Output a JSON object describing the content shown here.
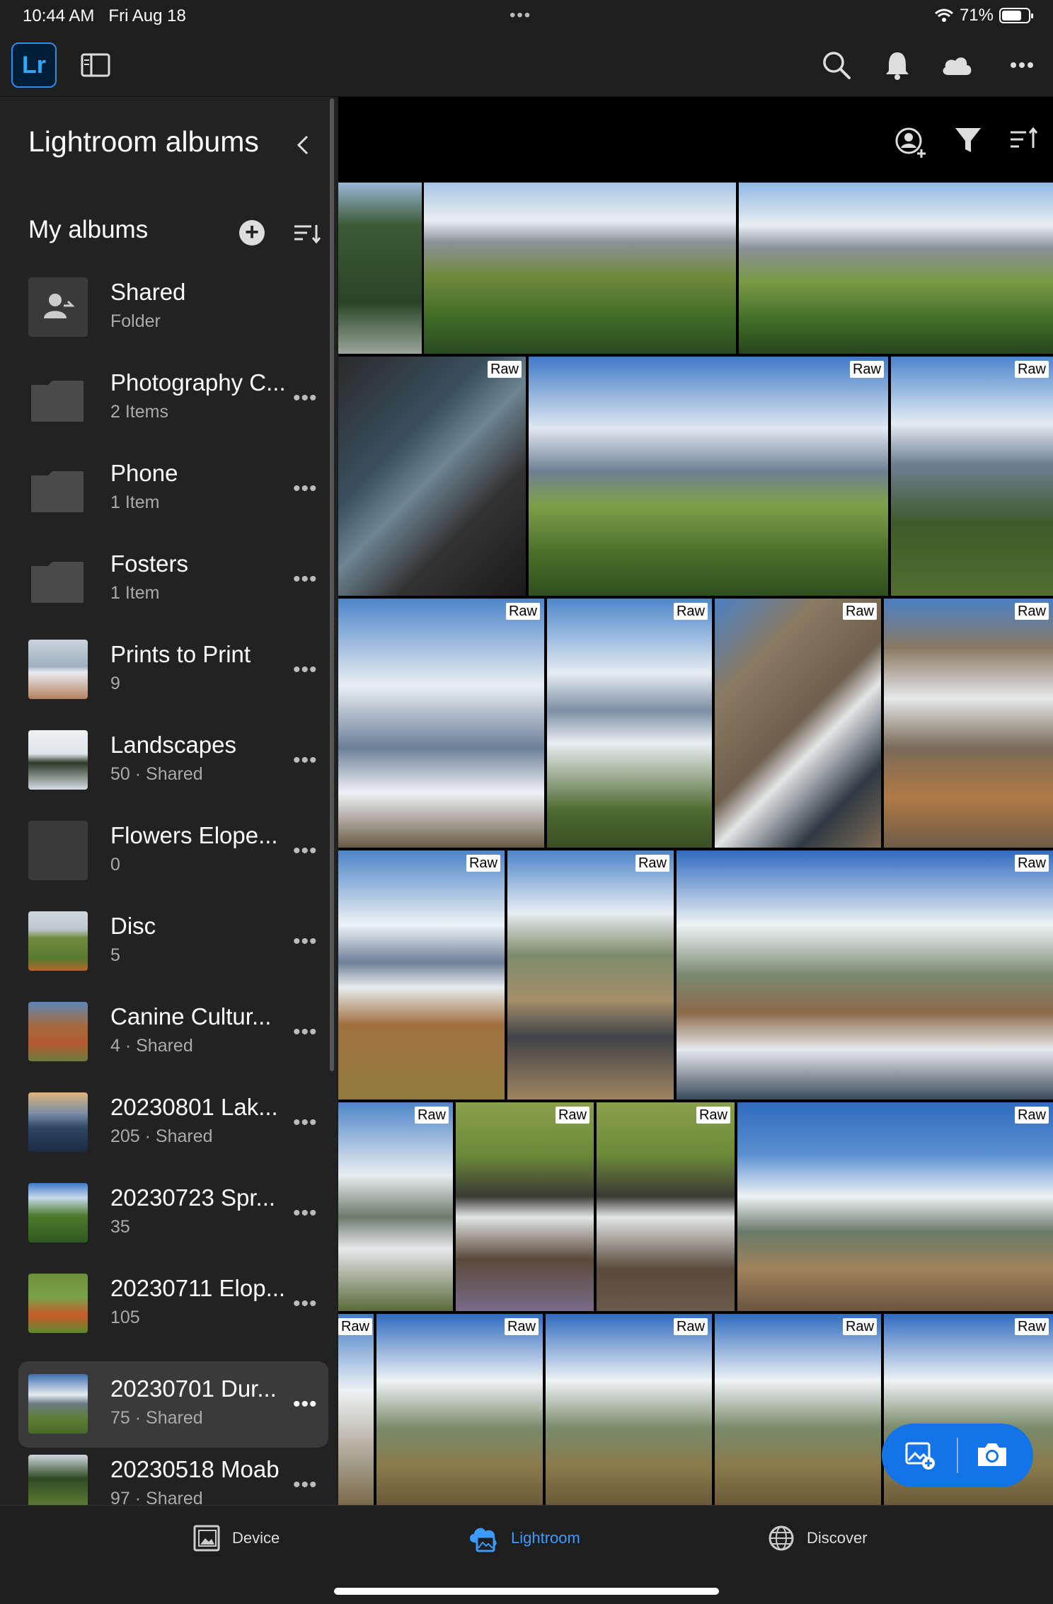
{
  "status": {
    "time": "10:44 AM",
    "date": "Fri Aug 18",
    "battery": "71%",
    "battery_level": 0.71
  },
  "appbar": {
    "logo": "Lr",
    "icons": [
      "sidebar-toggle-icon",
      "search-icon",
      "bell-icon",
      "cloud-icon",
      "more-icon"
    ]
  },
  "sidebar": {
    "title": "Lightroom albums",
    "section": "My albums",
    "albums": [
      {
        "name": "Shared",
        "sub": "Folder"
      },
      {
        "name": "Photography C...",
        "sub": "2 Items"
      },
      {
        "name": "Phone",
        "sub": "1 Item"
      },
      {
        "name": "Fosters",
        "sub": "1 Item"
      },
      {
        "name": "Prints to Print",
        "sub": "9"
      },
      {
        "name": "Landscapes",
        "sub": "50 · Shared"
      },
      {
        "name": "Flowers Elope...",
        "sub": "0"
      },
      {
        "name": "Disc",
        "sub": "5"
      },
      {
        "name": "Canine Cultur...",
        "sub": "4 · Shared"
      },
      {
        "name": "20230801 Lak...",
        "sub": "205 · Shared"
      },
      {
        "name": "20230723 Spr...",
        "sub": "35"
      },
      {
        "name": "20230711 Elop...",
        "sub": "105"
      },
      {
        "name": "20230701 Dur...",
        "sub": "75 · Shared"
      },
      {
        "name": "20230518 Moab",
        "sub": "97 · Shared"
      }
    ]
  },
  "grid": {
    "badge": "Raw",
    "toolbar_icons": [
      "add-person-icon",
      "filter-icon",
      "sort-icon"
    ]
  },
  "tabs": {
    "device": "Device",
    "lightroom": "Lightroom",
    "discover": "Discover"
  },
  "colors": {
    "accent": "#1473e6",
    "active_tab": "#3b9bff"
  }
}
